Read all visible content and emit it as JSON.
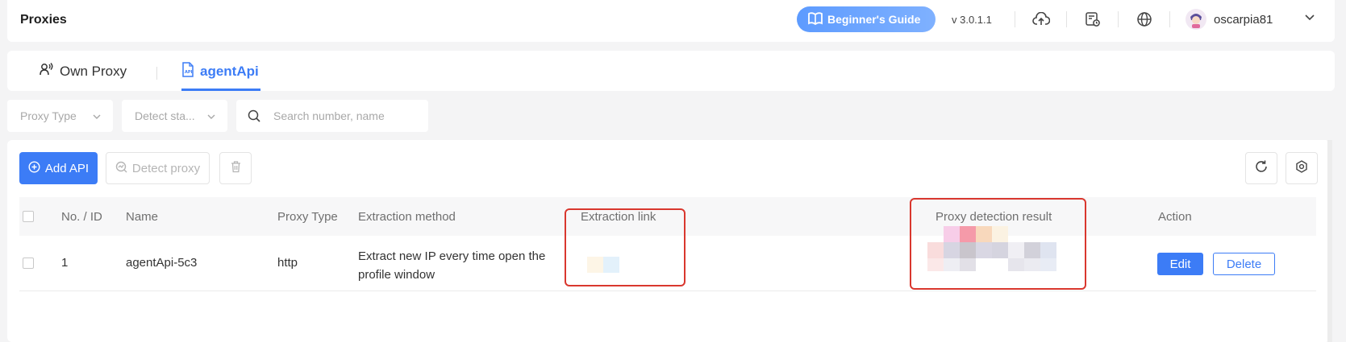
{
  "header": {
    "title": "Proxies",
    "guide_button": "Beginner's Guide",
    "version": "v 3.0.1.1",
    "username": "oscarpia81",
    "icons": [
      "cloud-upload-icon",
      "calendar-clock-icon",
      "globe-icon",
      "chevron-down-icon"
    ]
  },
  "tabs": [
    {
      "label": "Own Proxy",
      "icon": "user-signal-icon",
      "active": false
    },
    {
      "label": "agentApi",
      "icon": "api-file-icon",
      "active": true
    }
  ],
  "filters": {
    "proxy_type_placeholder": "Proxy Type",
    "detect_status_placeholder": "Detect sta...",
    "search_placeholder": "Search number, name"
  },
  "toolbar": {
    "add_label": "Add API",
    "detect_label": "Detect proxy"
  },
  "table": {
    "columns": [
      "No. / ID",
      "Name",
      "Proxy Type",
      "Extraction method",
      "Extraction link",
      "Proxy detection result",
      "Action"
    ],
    "rows": [
      {
        "id": "1",
        "name": "agentApi-5c3",
        "proxy_type": "http",
        "method": "Extract new IP every time open the profile window",
        "edit": "Edit",
        "delete": "Delete"
      }
    ]
  },
  "colors": {
    "accent": "#3c7cf6",
    "highlight": "#d9372e"
  }
}
